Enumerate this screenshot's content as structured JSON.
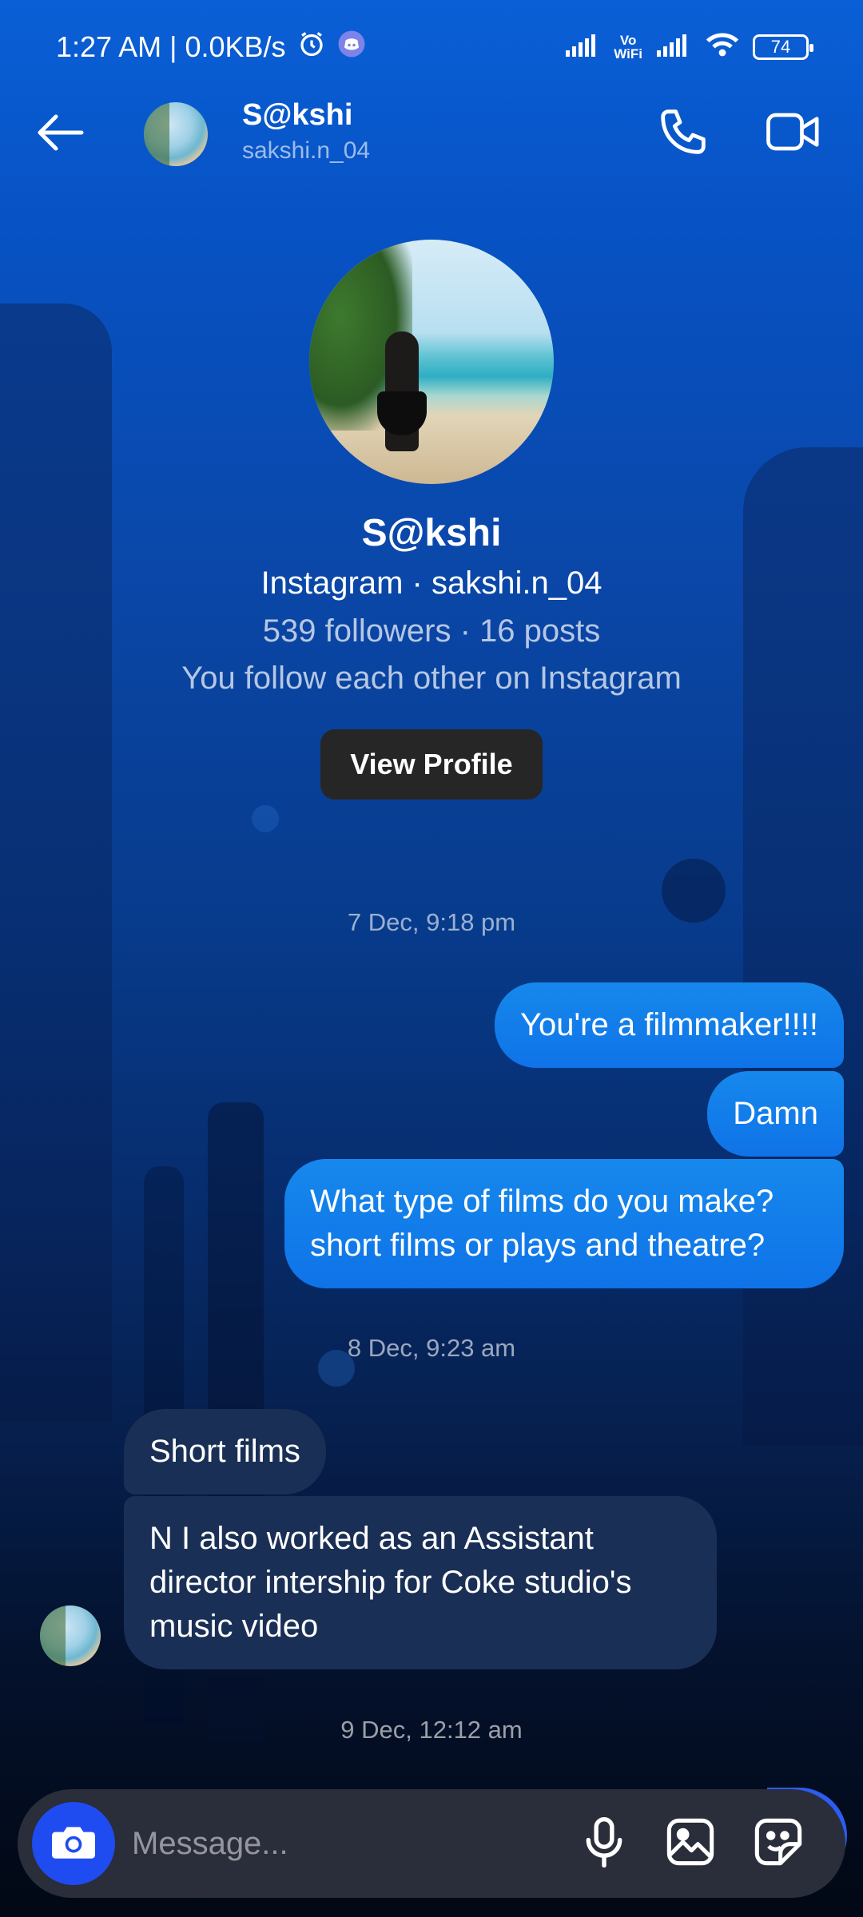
{
  "status_bar": {
    "time_speed": "1:27 AM | 0.0KB/s",
    "network_label_top": "Vo",
    "network_label_bottom": "WiFi",
    "battery": "74",
    "icons": [
      "alarm-icon",
      "discord-icon",
      "signal-icon",
      "vowifi-icon",
      "signal-icon",
      "wifi-icon",
      "battery-icon"
    ]
  },
  "header": {
    "name": "S@kshi",
    "handle": "sakshi.n_04",
    "icons": [
      "back-arrow-icon",
      "phone-icon",
      "video-camera-icon"
    ]
  },
  "profile": {
    "name": "S@kshi",
    "platform_handle": "Instagram · sakshi.n_04",
    "stats": "539 followers · 16 posts",
    "relation": "You follow each other on Instagram",
    "button_label": "View Profile"
  },
  "conversation": {
    "groups": [
      {
        "timestamp": "7 Dec, 9:18 pm",
        "messages": [
          {
            "direction": "sent",
            "text": "You're a filmmaker!!!!"
          },
          {
            "direction": "sent",
            "text": "Damn"
          },
          {
            "direction": "sent",
            "text": "What type of films do you make? short films or plays and theatre?"
          }
        ]
      },
      {
        "timestamp": "8 Dec, 9:23 am",
        "messages": [
          {
            "direction": "received",
            "text": "Short films"
          },
          {
            "direction": "received",
            "text": "N I also worked as an Assistant director intership for Coke studio's music video"
          }
        ]
      },
      {
        "timestamp": "9 Dec, 12:12 am",
        "messages": []
      }
    ]
  },
  "composer": {
    "placeholder": "Message...",
    "icons": [
      "camera-icon",
      "microphone-icon",
      "gallery-icon",
      "sticker-icon"
    ]
  },
  "colors": {
    "sent_bubble": "#1688ec",
    "received_bubble": "#1a2f55",
    "camera_button": "#1f4cf0",
    "view_profile_button": "#262626"
  }
}
